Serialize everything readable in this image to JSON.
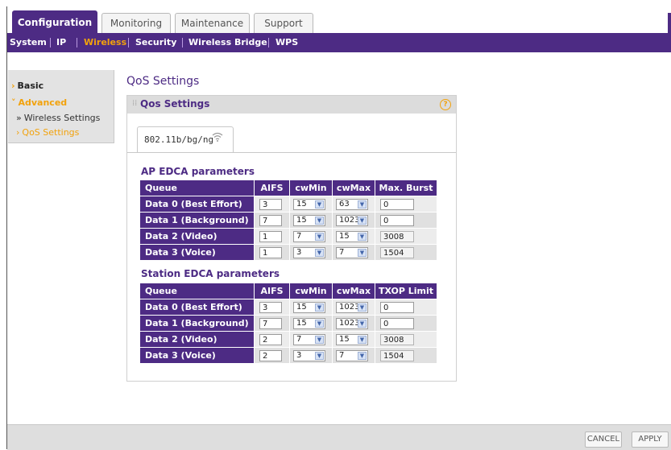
{
  "top_tabs": [
    "Configuration",
    "Monitoring",
    "Maintenance",
    "Support"
  ],
  "nav": {
    "items": [
      "System",
      "IP",
      "Wireless",
      "Security",
      "Wireless Bridge",
      "WPS"
    ],
    "active": "Wireless"
  },
  "sidebar": {
    "basic": "Basic",
    "advanced": "Advanced",
    "items": [
      "Wireless Settings",
      "QoS Settings"
    ]
  },
  "page_title": "QoS Settings",
  "panel_title": "Qos Settings",
  "help_icon": "?",
  "mode_tab": "802.11b/bg/ng",
  "ap_edca": {
    "title": "AP EDCA parameters",
    "headers": [
      "Queue",
      "AIFS",
      "cwMin",
      "cwMax",
      "Max. Burst"
    ],
    "rows": [
      {
        "queue": "Data 0 (Best Effort)",
        "aifs": "3",
        "cwmin": "15",
        "cwmax": "63",
        "burst": "0"
      },
      {
        "queue": "Data 1 (Background)",
        "aifs": "7",
        "cwmin": "15",
        "cwmax": "1023",
        "burst": "0"
      },
      {
        "queue": "Data 2 (Video)",
        "aifs": "1",
        "cwmin": "7",
        "cwmax": "15",
        "burst": "3008"
      },
      {
        "queue": "Data 3 (Voice)",
        "aifs": "1",
        "cwmin": "3",
        "cwmax": "7",
        "burst": "1504"
      }
    ]
  },
  "sta_edca": {
    "title": "Station EDCA parameters",
    "headers": [
      "Queue",
      "AIFS",
      "cwMin",
      "cwMax",
      "TXOP Limit"
    ],
    "rows": [
      {
        "queue": "Data 0 (Best Effort)",
        "aifs": "3",
        "cwmin": "15",
        "cwmax": "1023",
        "txop": "0"
      },
      {
        "queue": "Data 1 (Background)",
        "aifs": "7",
        "cwmin": "15",
        "cwmax": "1023",
        "txop": "0"
      },
      {
        "queue": "Data 2 (Video)",
        "aifs": "2",
        "cwmin": "7",
        "cwmax": "15",
        "txop": "3008"
      },
      {
        "queue": "Data 3 (Voice)",
        "aifs": "2",
        "cwmin": "3",
        "cwmax": "7",
        "txop": "1504"
      }
    ]
  },
  "footer": {
    "cancel": "CANCEL",
    "apply": "APPLY"
  },
  "colors": {
    "brand_purple": "#4d2b84",
    "accent_orange": "#f2a20c"
  }
}
